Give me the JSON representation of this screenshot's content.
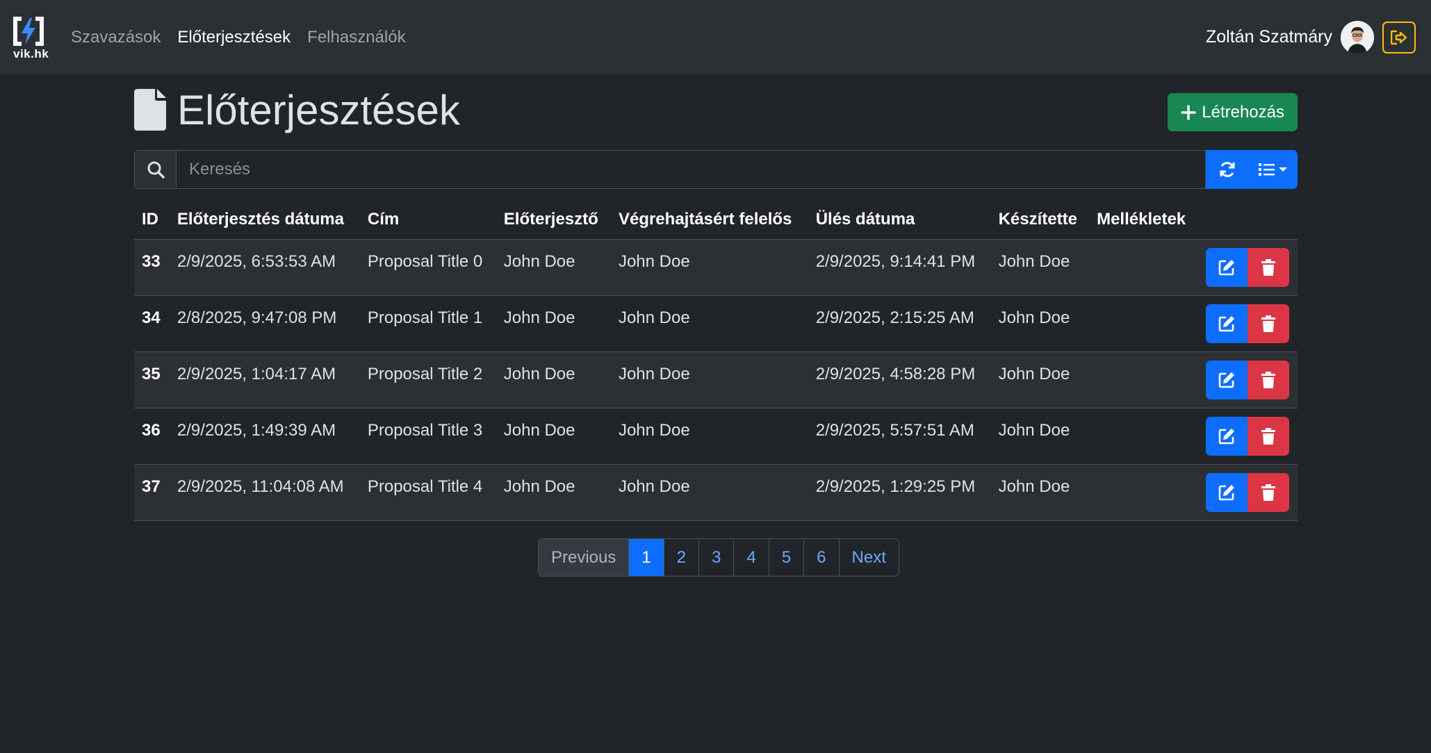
{
  "nav": {
    "logo_text": "vik.hk",
    "links": [
      {
        "label": "Szavazások",
        "active": false
      },
      {
        "label": "Előterjesztések",
        "active": true
      },
      {
        "label": "Felhasználók",
        "active": false
      }
    ],
    "user_name": "Zoltán Szatmáry",
    "avatar_icon": "user-avatar",
    "logout_icon": "sign-out-icon"
  },
  "page": {
    "title": "Előterjesztések",
    "title_icon": "file-icon",
    "create_label": "Létrehozás",
    "create_icon": "plus-icon"
  },
  "search": {
    "placeholder": "Keresés",
    "value": "",
    "icon": "search-icon",
    "refresh_icon": "refresh-icon",
    "list_icon": "list-dropdown-icon"
  },
  "table": {
    "headers": [
      "ID",
      "Előterjesztés dátuma",
      "Cím",
      "Előterjesztő",
      "Végrehajtásért felelős",
      "Ülés dátuma",
      "Készítette",
      "Mellékletek",
      ""
    ],
    "rows": [
      {
        "id": "33",
        "date": "2/9/2025, 6:53:53 AM",
        "title": "Proposal Title 0",
        "proposer": "John Doe",
        "responsible": "John Doe",
        "meeting": "2/9/2025, 9:14:41 PM",
        "creator": "John Doe",
        "attachments": ""
      },
      {
        "id": "34",
        "date": "2/8/2025, 9:47:08 PM",
        "title": "Proposal Title 1",
        "proposer": "John Doe",
        "responsible": "John Doe",
        "meeting": "2/9/2025, 2:15:25 AM",
        "creator": "John Doe",
        "attachments": ""
      },
      {
        "id": "35",
        "date": "2/9/2025, 1:04:17 AM",
        "title": "Proposal Title 2",
        "proposer": "John Doe",
        "responsible": "John Doe",
        "meeting": "2/9/2025, 4:58:28 PM",
        "creator": "John Doe",
        "attachments": ""
      },
      {
        "id": "36",
        "date": "2/9/2025, 1:49:39 AM",
        "title": "Proposal Title 3",
        "proposer": "John Doe",
        "responsible": "John Doe",
        "meeting": "2/9/2025, 5:57:51 AM",
        "creator": "John Doe",
        "attachments": ""
      },
      {
        "id": "37",
        "date": "2/9/2025, 11:04:08 AM",
        "title": "Proposal Title 4",
        "proposer": "John Doe",
        "responsible": "John Doe",
        "meeting": "2/9/2025, 1:29:25 PM",
        "creator": "John Doe",
        "attachments": ""
      }
    ],
    "edit_icon": "edit-icon",
    "delete_icon": "trash-icon"
  },
  "pagination": {
    "previous": "Previous",
    "pages": [
      "1",
      "2",
      "3",
      "4",
      "5",
      "6"
    ],
    "current": "1",
    "next": "Next"
  },
  "colors": {
    "background": "#212529",
    "navbar": "#2b3035",
    "primary": "#0d6efd",
    "success": "#198754",
    "danger": "#dc3545",
    "warning": "#ffc107"
  }
}
